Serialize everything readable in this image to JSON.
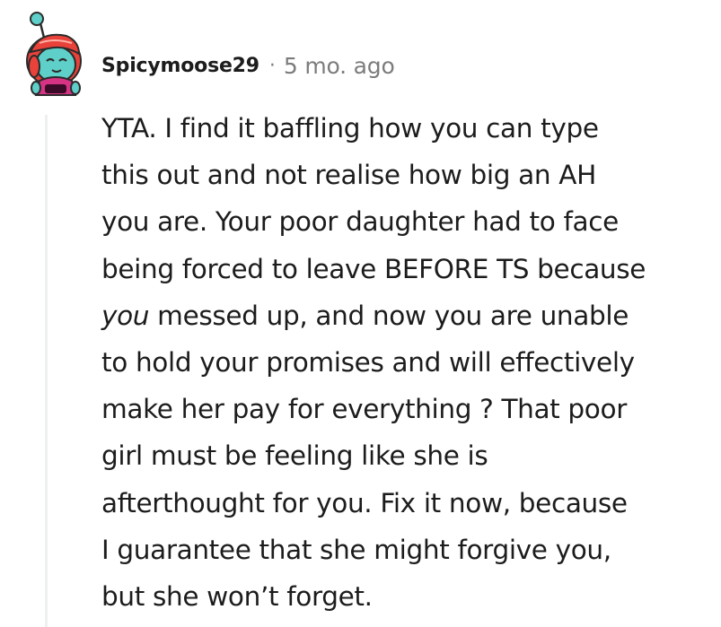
{
  "comment": {
    "author": "Spicymoose29",
    "separator": "·",
    "timestamp": "5 mo. ago",
    "avatar_icon": "snoo-avatar-icon",
    "colors": {
      "text": "#1c1c1c",
      "meta": "#7c7c7c",
      "thread_line": "#edeff1",
      "avatar_hair": "#e8423a",
      "avatar_face": "#5fd0c9",
      "avatar_shirt": "#d63384"
    },
    "body_lines": [
      "YTA. I find it baffling how you can type",
      "this out and not realise how big an AH",
      "you are. Your poor daughter had to face",
      "being forced to leave BEFORE TS because",
      "",
      "to hold your promises and will effectively",
      "make her pay for everything ? That poor",
      "girl must be feeling like she is",
      "afterthought for you. Fix it now, because",
      "I guarantee that she might forgive you,",
      "but she won’t forget."
    ],
    "line5_em": "you",
    "line5_rest": " messed up, and now you are unable"
  }
}
